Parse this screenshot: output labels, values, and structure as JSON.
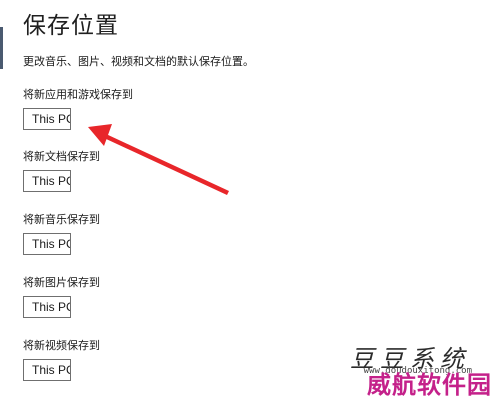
{
  "header": {
    "title": "保存位置",
    "description": "更改音乐、图片、视频和文档的默认保存位置。"
  },
  "settings": [
    {
      "label": "将新应用和游戏保存到",
      "value": "This PC"
    },
    {
      "label": "将新文档保存到",
      "value": "This PC"
    },
    {
      "label": "将新音乐保存到",
      "value": "This PC"
    },
    {
      "label": "将新图片保存到",
      "value": "This PC"
    },
    {
      "label": "将新视频保存到",
      "value": "This PC"
    }
  ],
  "watermark": {
    "line1": "豆豆系统",
    "url": "www.doudouxitong.com",
    "line2": "威航软件园"
  },
  "colors": {
    "accent_bar": "#4a5a70",
    "annotation_arrow": "#e8262a",
    "watermark_magenta": "#c4218a"
  },
  "icons": {
    "annotation": "red-arrow-icon"
  }
}
